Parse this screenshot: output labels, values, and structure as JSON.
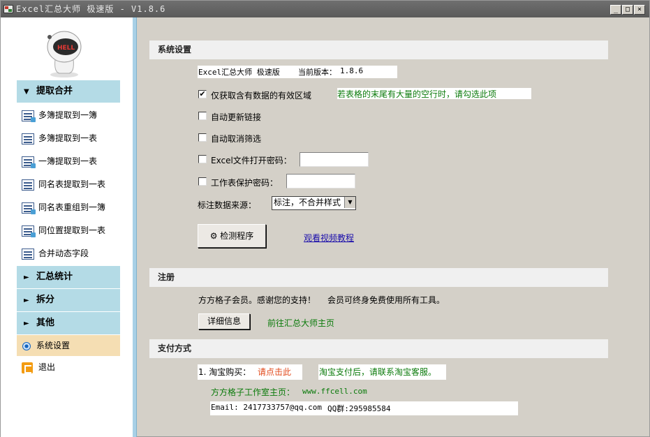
{
  "window": {
    "title": "Excel汇总大师 极速版 - V1.8.6",
    "min": "_",
    "max": "□",
    "close": "×"
  },
  "sidebar": {
    "sections": [
      {
        "label": "提取合并",
        "arrow": "▼"
      },
      {
        "label": "汇总统计",
        "arrow": "►"
      },
      {
        "label": "拆分",
        "arrow": "►"
      },
      {
        "label": "其他",
        "arrow": "►"
      }
    ],
    "items": [
      "多簿提取到一簿",
      "多簿提取到一表",
      "一簿提取到一表",
      "同名表提取到一表",
      "同名表重组到一簿",
      "同位置提取到一表",
      "合并动态字段"
    ],
    "settings": "系统设置",
    "exit": "退出"
  },
  "system_settings": {
    "header": "系统设置",
    "app_name": "Excel汇总大师 极速版",
    "version_label": "当前版本：",
    "version": "1.8.6",
    "options": [
      {
        "label": "仅获取含有数据的有效区域",
        "checked": true
      },
      {
        "label": "自动更新链接",
        "checked": false
      },
      {
        "label": "自动取消筛选",
        "checked": false
      },
      {
        "label": "Excel文件打开密码：",
        "checked": false
      },
      {
        "label": "工作表保护密码：",
        "checked": false
      }
    ],
    "hint": "若表格的末尾有大量的空行时，请勾选此项",
    "check_mark": "✔",
    "source_label": "标注数据来源：",
    "source_value": "标注，不合并样式",
    "check_button": "检测程序",
    "tutorial_link": "观看视频教程"
  },
  "register": {
    "header": "注册",
    "message": "方方格子会员。感谢您的支持！",
    "benefit": "会员可终身免费使用所有工具。",
    "detail_button": "详细信息",
    "homepage_link": "前往汇总大师主页"
  },
  "payment": {
    "header": "支付方式",
    "taobao_label": "1. 淘宝购买：",
    "taobao_link": "请点击此",
    "taobao_note": "淘宝支付后，请联系淘宝客服。",
    "studio_label": "方方格子工作室主页：",
    "studio_url": "www.ffcell.com",
    "email": "Email: 2417733757@qq.com",
    "qq": "QQ群:295985584"
  }
}
